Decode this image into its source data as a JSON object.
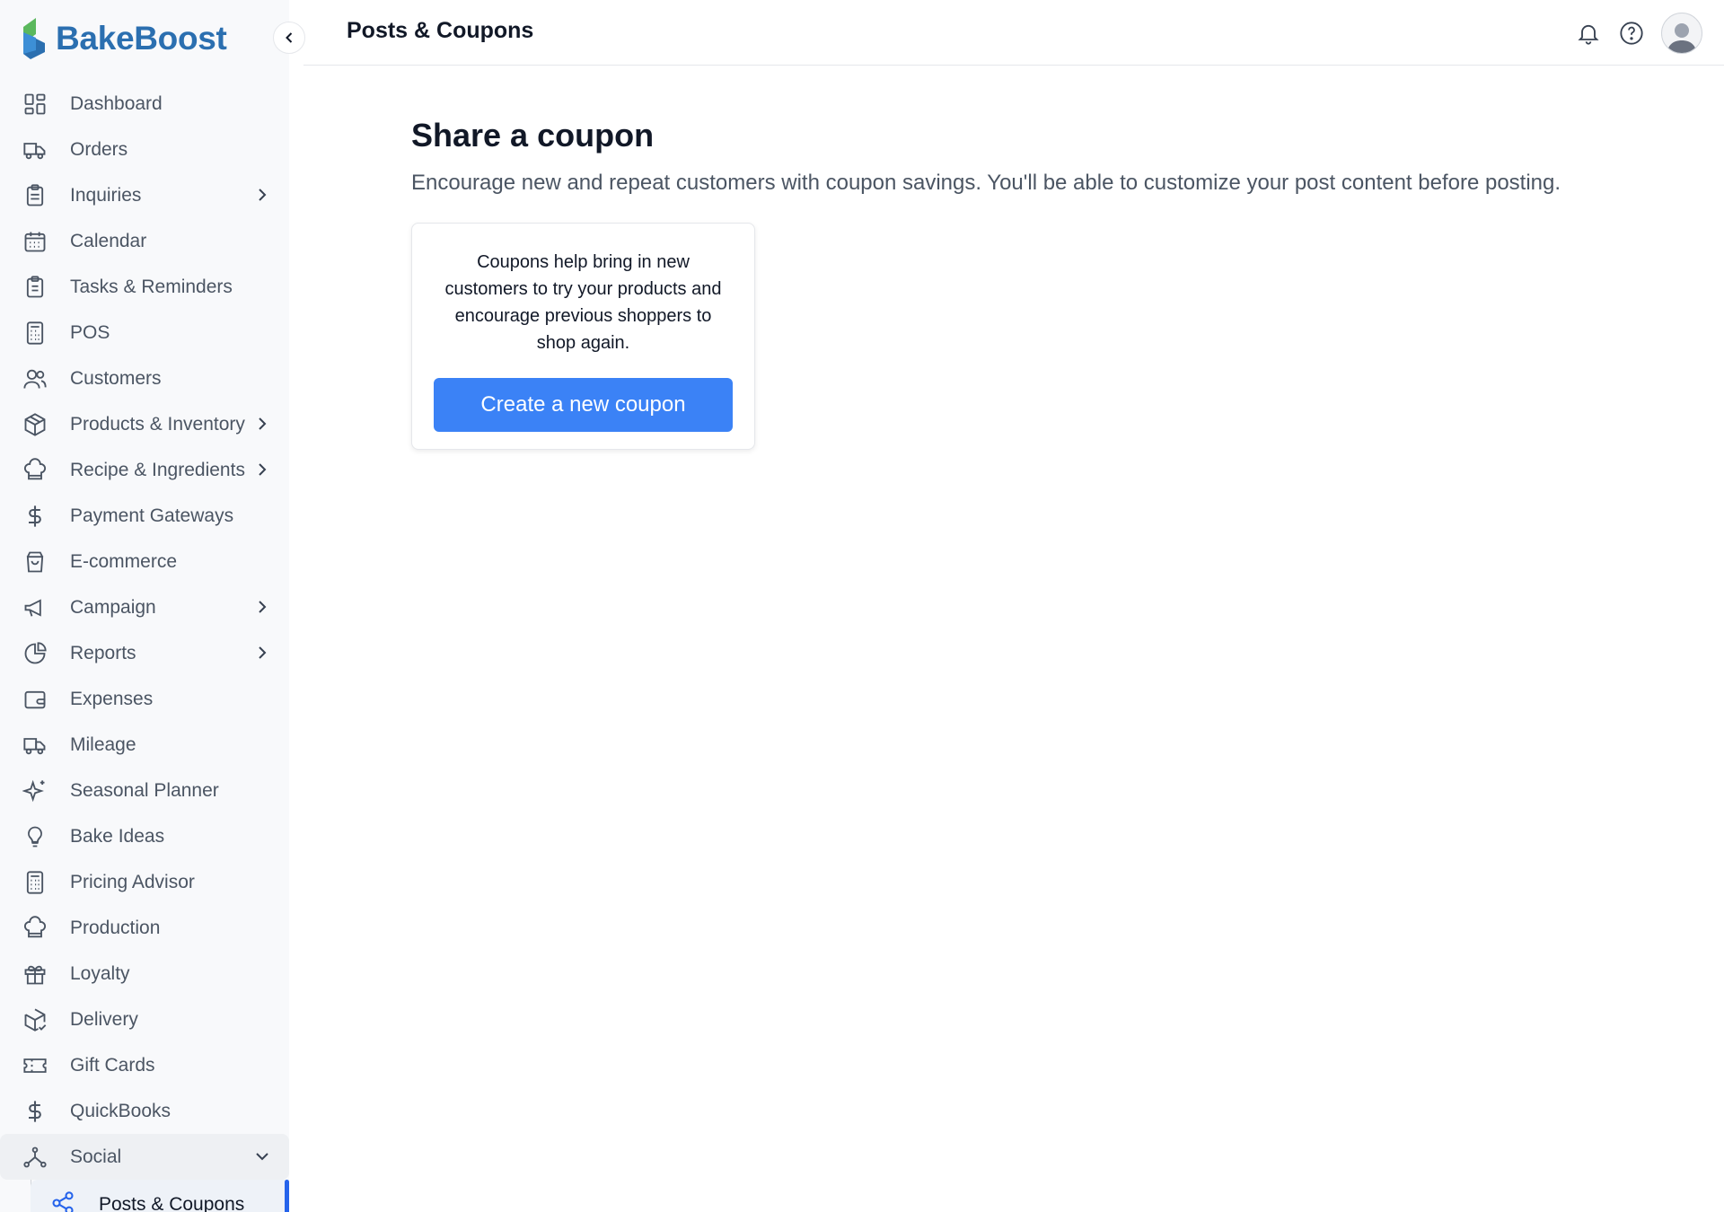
{
  "brand": {
    "name": "BakeBoost"
  },
  "header": {
    "title": "Posts & Coupons"
  },
  "sidebar": {
    "items": [
      {
        "label": "Dashboard",
        "icon": "dashboard-icon"
      },
      {
        "label": "Orders",
        "icon": "truck-icon"
      },
      {
        "label": "Inquiries",
        "icon": "clipboard-icon",
        "expandable": true
      },
      {
        "label": "Calendar",
        "icon": "calendar-icon"
      },
      {
        "label": "Tasks & Reminders",
        "icon": "clipboard-list-icon"
      },
      {
        "label": "POS",
        "icon": "calculator-icon"
      },
      {
        "label": "Customers",
        "icon": "users-icon"
      },
      {
        "label": "Products & Inventory",
        "icon": "box-icon",
        "expandable": true
      },
      {
        "label": "Recipe & Ingredients",
        "icon": "chef-hat-icon",
        "expandable": true
      },
      {
        "label": "Payment Gateways",
        "icon": "dollar-icon"
      },
      {
        "label": "E-commerce",
        "icon": "shopping-bag-icon"
      },
      {
        "label": "Campaign",
        "icon": "megaphone-icon",
        "expandable": true
      },
      {
        "label": "Reports",
        "icon": "pie-chart-icon",
        "expandable": true
      },
      {
        "label": "Expenses",
        "icon": "wallet-icon"
      },
      {
        "label": "Mileage",
        "icon": "truck-icon"
      },
      {
        "label": "Seasonal Planner",
        "icon": "sparkles-icon"
      },
      {
        "label": "Bake Ideas",
        "icon": "lightbulb-icon"
      },
      {
        "label": "Pricing Advisor",
        "icon": "calculator-icon"
      },
      {
        "label": "Production",
        "icon": "chef-hat-icon"
      },
      {
        "label": "Loyalty",
        "icon": "gift-icon"
      },
      {
        "label": "Delivery",
        "icon": "package-check-icon"
      },
      {
        "label": "Gift Cards",
        "icon": "ticket-icon"
      },
      {
        "label": "QuickBooks",
        "icon": "dollar-icon"
      },
      {
        "label": "Social",
        "icon": "network-icon",
        "expanded": true
      }
    ],
    "subitems": [
      {
        "label": "Posts & Coupons",
        "icon": "share-icon",
        "active": true
      }
    ]
  },
  "main": {
    "heading": "Share a coupon",
    "subtitle": "Encourage new and repeat customers with coupon savings. You'll be able to customize your post content before posting.",
    "card": {
      "text": "Coupons help bring in new customers to try your products and encourage previous shoppers to shop again.",
      "button_label": "Create a new coupon"
    }
  },
  "colors": {
    "brand_blue": "#2b6fb0",
    "brand_green": "#4caf50",
    "accent": "#3b82f6",
    "active_indicator": "#2563eb",
    "sidebar_bg": "#f8f9fb"
  }
}
